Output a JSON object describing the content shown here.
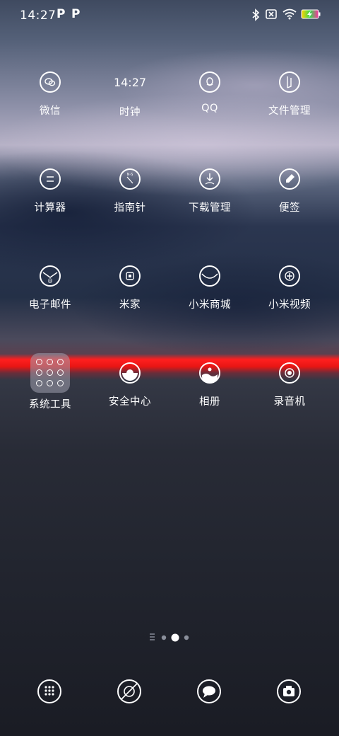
{
  "status_bar": {
    "time": "14:27",
    "notification_icons": [
      "P",
      "P"
    ],
    "right_icons": [
      "bluetooth-icon",
      "sim-off-icon",
      "wifi-icon",
      "battery-charging-icon"
    ]
  },
  "apps": [
    {
      "label": "微信",
      "icon": "wechat-icon"
    },
    {
      "label": "时钟",
      "icon": "clock-icon",
      "display": "14:27"
    },
    {
      "label": "QQ",
      "icon": "qq-icon"
    },
    {
      "label": "文件管理",
      "icon": "file-manager-icon"
    },
    {
      "label": "计算器",
      "icon": "calculator-icon"
    },
    {
      "label": "指南针",
      "icon": "compass-icon",
      "compass_text": "N-S"
    },
    {
      "label": "下载管理",
      "icon": "download-icon"
    },
    {
      "label": "便签",
      "icon": "notes-icon"
    },
    {
      "label": "电子邮件",
      "icon": "email-icon"
    },
    {
      "label": "米家",
      "icon": "mijia-icon"
    },
    {
      "label": "小米商城",
      "icon": "mi-store-icon"
    },
    {
      "label": "小米视频",
      "icon": "mi-video-icon"
    },
    {
      "label": "系统工具",
      "icon": "system-tools-folder-icon"
    },
    {
      "label": "安全中心",
      "icon": "security-center-icon"
    },
    {
      "label": "相册",
      "icon": "gallery-icon"
    },
    {
      "label": "录音机",
      "icon": "recorder-icon"
    }
  ],
  "page_indicator": {
    "pages": 3,
    "current": 2,
    "has_menu": true
  },
  "dock": [
    {
      "icon": "app-drawer-icon"
    },
    {
      "icon": "browser-icon"
    },
    {
      "icon": "messages-icon"
    },
    {
      "icon": "camera-icon"
    }
  ]
}
